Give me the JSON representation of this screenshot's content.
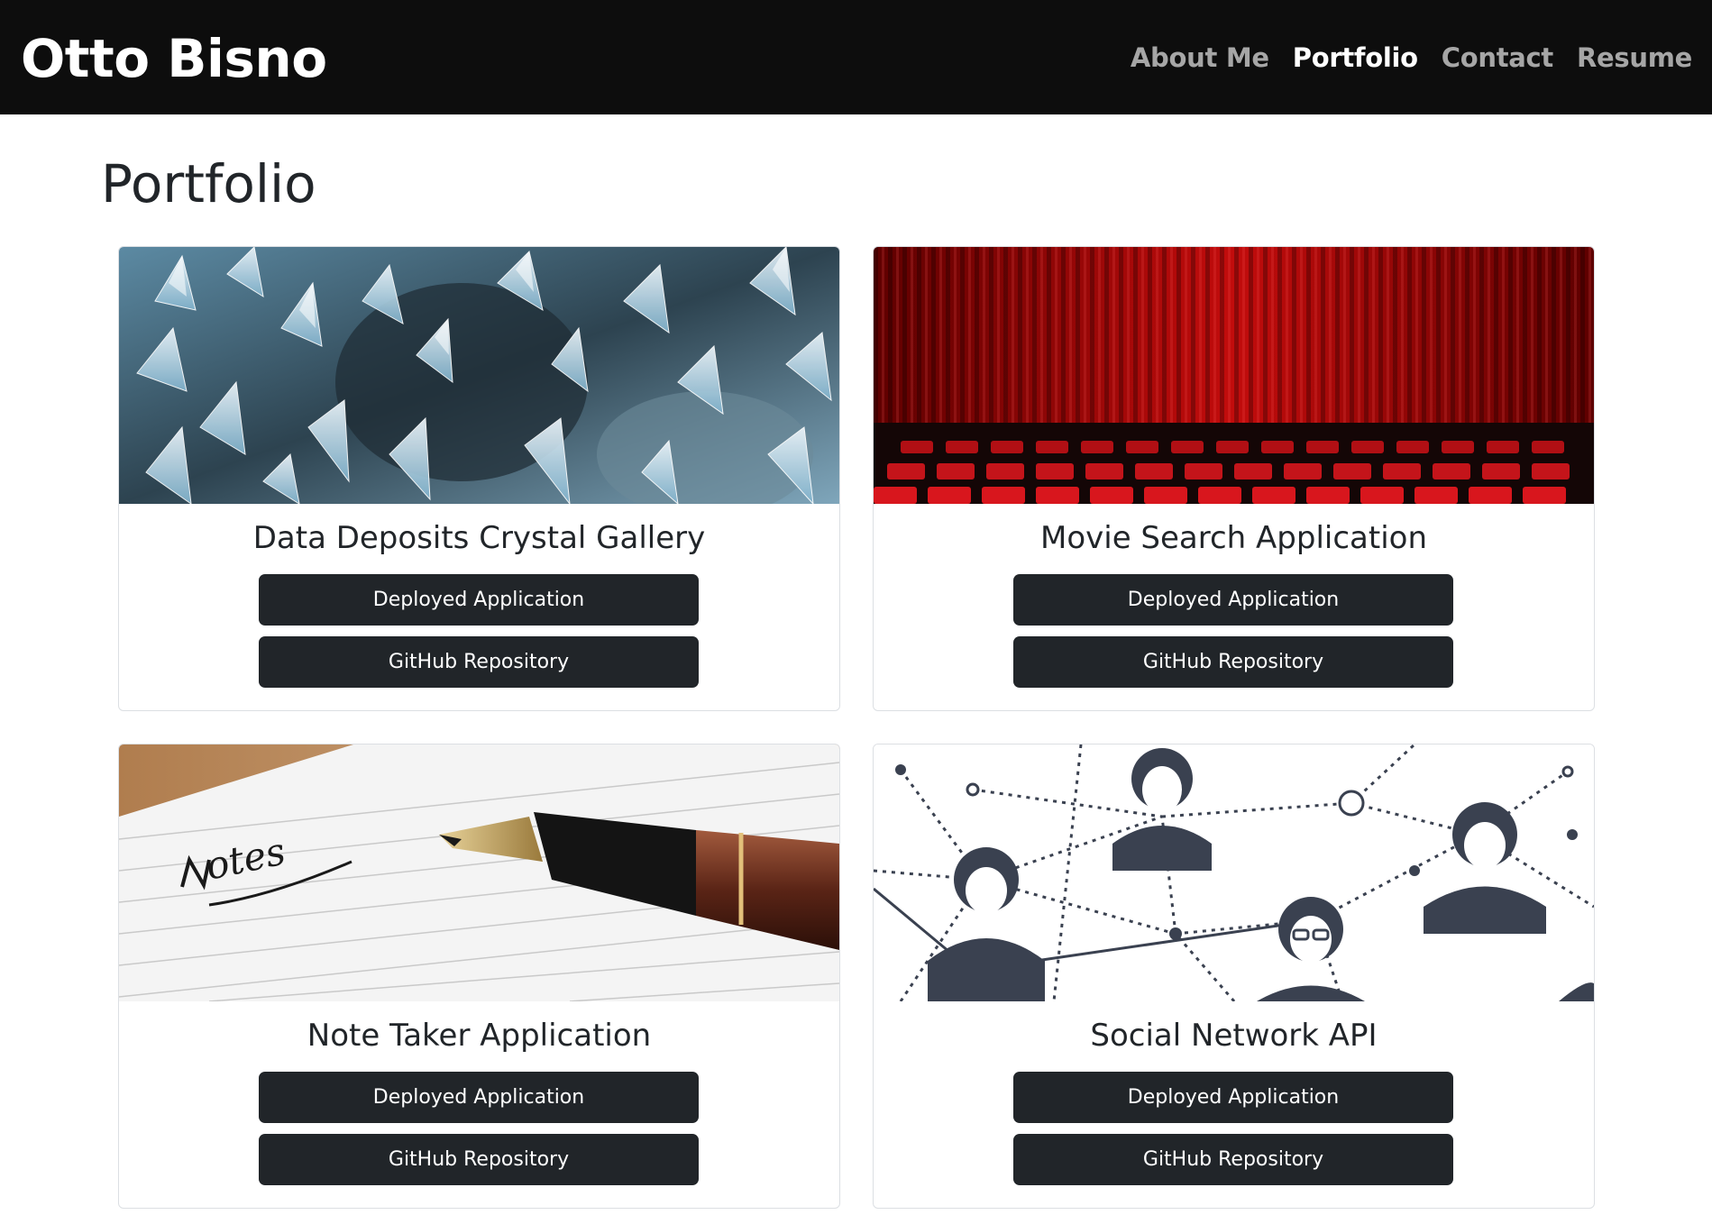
{
  "navbar": {
    "brand": "Otto Bisno",
    "links": [
      {
        "label": "About Me",
        "active": false
      },
      {
        "label": "Portfolio",
        "active": true
      },
      {
        "label": "Contact",
        "active": false
      },
      {
        "label": "Resume",
        "active": false
      }
    ]
  },
  "page": {
    "title": "Portfolio"
  },
  "projects": [
    {
      "title": "Data Deposits Crystal Gallery",
      "image": "crystal-image",
      "deploy_label": "Deployed Application",
      "repo_label": "GitHub Repository"
    },
    {
      "title": "Movie Search Application",
      "image": "theater-curtain-image",
      "deploy_label": "Deployed Application",
      "repo_label": "GitHub Repository"
    },
    {
      "title": "Note Taker Application",
      "image": "notes-pen-image",
      "deploy_label": "Deployed Application",
      "repo_label": "GitHub Repository"
    },
    {
      "title": "Social Network API",
      "image": "social-network-image",
      "deploy_label": "Deployed Application",
      "repo_label": "GitHub Repository"
    }
  ],
  "colors": {
    "navbar_bg": "#0d0d0d",
    "nav_inactive": "#a6a6a6",
    "nav_active": "#ffffff",
    "button_bg": "#212529",
    "text": "#212529"
  }
}
